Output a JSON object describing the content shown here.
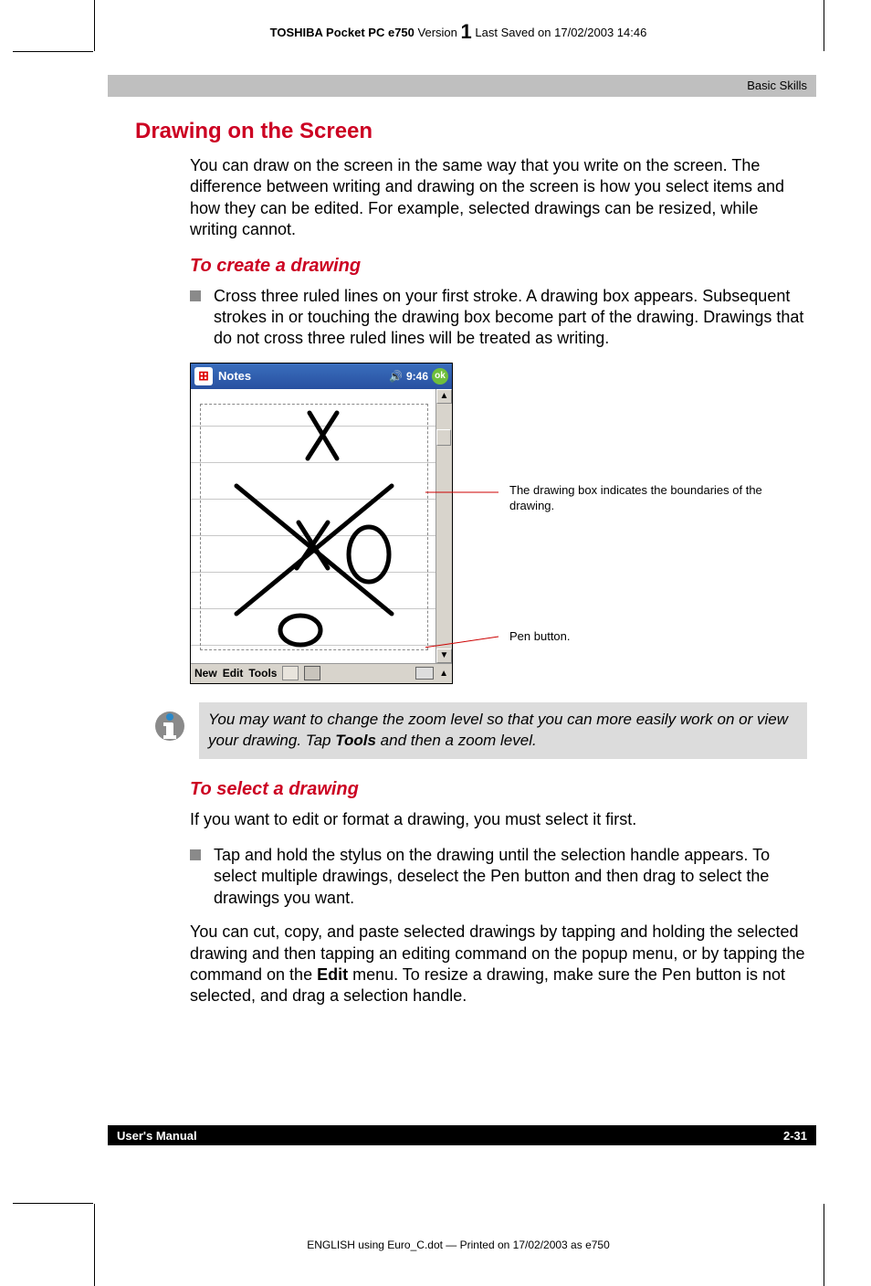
{
  "header": {
    "product_bold": "TOSHIBA Pocket PC e750",
    "version_word": "Version",
    "version_num": "1",
    "saved": "Last Saved on 17/02/2003 14:46"
  },
  "section_band": "Basic Skills",
  "h2": "Drawing on the Screen",
  "intro": "You can draw on the screen in the same way that you write on the screen. The difference between writing and drawing on the screen is how you select items and how they can be edited. For example, selected drawings can be resized, while writing cannot.",
  "sub1": "To create a drawing",
  "bullet1": "Cross three ruled lines on your first stroke. A drawing box appears. Subsequent strokes in or touching the drawing box become part of the drawing. Drawings that do not cross three ruled lines will be treated as writing.",
  "screenshot": {
    "title": "Notes",
    "time": "9:46",
    "ok": "ok",
    "menu_new": "New",
    "menu_edit": "Edit",
    "menu_tools": "Tools"
  },
  "callouts": {
    "drawing_box": "The drawing box indicates the boundaries of the drawing.",
    "pen_button": "Pen button."
  },
  "info_note": {
    "pre": "You may want to change the zoom level so that you can more easily work on or view your drawing. Tap ",
    "bold": "Tools",
    "post": " and then a zoom level."
  },
  "sub2": "To select a drawing",
  "p2": "If you want to edit or format a drawing, you must select it first.",
  "bullet2": "Tap and hold the stylus on the drawing until the selection handle appears. To select multiple drawings, deselect the Pen button and then drag to select the drawings you want.",
  "p3_pre": "You can cut, copy, and paste selected drawings by tapping and holding the selected drawing and then tapping an editing command on the popup menu, or by tapping the command on the ",
  "p3_bold": "Edit",
  "p3_post": " menu. To resize a drawing, make sure the Pen button is not selected, and drag a selection handle.",
  "footer": {
    "left": "User's Manual",
    "right": "2-31"
  },
  "bottom_print": "ENGLISH using Euro_C.dot — Printed on 17/02/2003 as e750"
}
